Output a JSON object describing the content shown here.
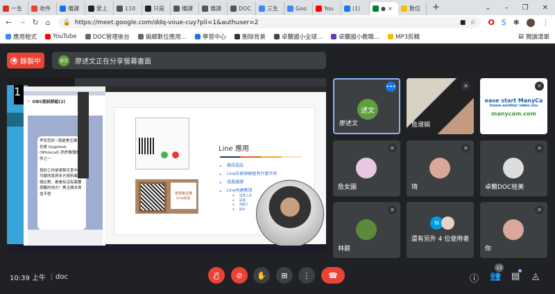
{
  "browser": {
    "tabs": [
      {
        "label": "一生",
        "color": "#d93025"
      },
      {
        "label": "收件",
        "color": "#ea4335"
      },
      {
        "label": "備課",
        "color": "#1a73e8"
      },
      {
        "label": "愛上",
        "color": "#222"
      },
      {
        "label": "110",
        "color": "#555"
      },
      {
        "label": "只是",
        "color": "#222"
      },
      {
        "label": "備課",
        "color": "#555"
      },
      {
        "label": "備課",
        "color": "#555"
      },
      {
        "label": "DOC",
        "color": "#555"
      },
      {
        "label": "三生",
        "color": "#4285f4"
      },
      {
        "label": "Goo",
        "color": "#4285f4"
      },
      {
        "label": "You",
        "color": "#ff0000"
      },
      {
        "label": "(1)",
        "color": "#1877f2"
      },
      {
        "label": "●",
        "color": "#00832d",
        "active": true
      },
      {
        "label": "數位",
        "color": "#fbbc04"
      }
    ],
    "new_tab": "+",
    "url": "https://meet.google.com/ddq-voue-cuy?pli=1&authuser=2",
    "bookmarks": [
      {
        "label": "應用程式",
        "color": "#4285f4"
      },
      {
        "label": "YouTube",
        "color": "#ff0000"
      },
      {
        "label": "DOC管理後台",
        "color": "#666"
      },
      {
        "label": "偏鄉數位應用...",
        "color": "#666"
      },
      {
        "label": "學習中心",
        "color": "#1a73e8"
      },
      {
        "label": "刪除背景",
        "color": "#333"
      },
      {
        "label": "卓蘭國小全球...",
        "color": "#444"
      },
      {
        "label": "卓蘭國小教職...",
        "color": "#673ab7"
      },
      {
        "label": "MP3剪輯",
        "color": "#fbbc04"
      }
    ],
    "reading_list": "閱讀清單"
  },
  "meet": {
    "recording_label": "錄製中",
    "presenter_initials": "述文",
    "presenting_text": "廖述文正在分享螢幕畫面",
    "share": {
      "phone_chat_title": "OBS測試群組(2)",
      "chat_message": "早安您好~我是美玉姨，也是 Gogolook (Whoscall) 防詐聯盟的夥伴之一\n\n我的工作是將聊天室中的可疑訊息與多方資料庫做個比對，看看有沒有需要提醒的地方！美玉姨本身並不提",
      "slide_title": "Line 應用",
      "slide_bullets": [
        "揪訊長話",
        "Line社群與群組有什麼不同",
        "成員邀請",
        "Line內建應用"
      ],
      "slide_sub": [
        "出席人名",
        "記事",
        "待辦了",
        "照片"
      ],
      "qr_caption": "搜尋美玉姨 Line好友"
    },
    "participants": [
      {
        "name": "廖述文",
        "initials": "述文",
        "avatar_color": "#5f9e3a",
        "active": true
      },
      {
        "name": "詹淑娟",
        "video": true,
        "muted": true
      },
      {
        "name": "",
        "video_text": [
          "ease start ManyCa",
          "hoose another video sou",
          "manycam.com"
        ],
        "muted": true
      },
      {
        "name": "詹女園",
        "muted": true,
        "avatar_color": "#e8c9e3"
      },
      {
        "name": "琦",
        "muted": true,
        "avatar_color": "#d9a89a"
      },
      {
        "name": "卓蘭DOC桂美",
        "muted": true,
        "avatar_color": "#ddd"
      },
      {
        "name": "林碧",
        "muted": true,
        "avatar_color": "#5a8a3a"
      },
      {
        "name": "還有另外 4 位使用者",
        "extra_initial": "N",
        "extra_color": "#039be5"
      },
      {
        "name": "你",
        "muted": true,
        "avatar_color": "#d9a89a"
      }
    ],
    "bottom": {
      "time": "10:39 上午",
      "meeting_code": "doc",
      "participant_count": "13"
    },
    "colors": {
      "danger": "#ea4335",
      "control": "#3c4043",
      "accent": "#1a73e8"
    }
  }
}
